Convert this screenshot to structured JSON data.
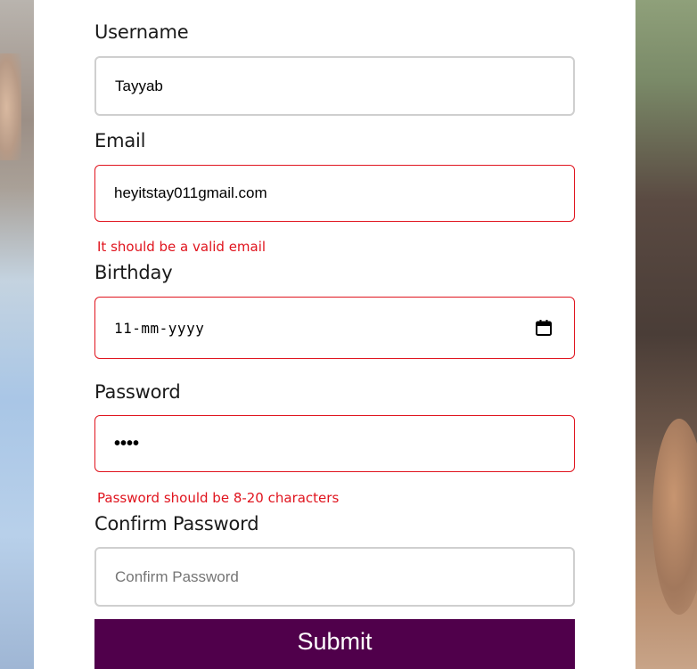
{
  "form": {
    "username": {
      "label": "Username",
      "value": "Tayyab"
    },
    "email": {
      "label": "Email",
      "value": "heyitstay011gmail.com",
      "error": "It should be a valid email"
    },
    "birthday": {
      "label": "Birthday",
      "value": "11-mm-yyyy",
      "icon": "calendar-icon"
    },
    "password": {
      "label": "Password",
      "value": "••••",
      "error": "Password should be 8-20 characters"
    },
    "confirm_password": {
      "label": "Confirm Password",
      "placeholder": "Confirm Password"
    },
    "submit_label": "Submit"
  },
  "colors": {
    "error": "#e0141e",
    "submit_bg": "#50004b",
    "input_border": "#cfcfcf"
  }
}
